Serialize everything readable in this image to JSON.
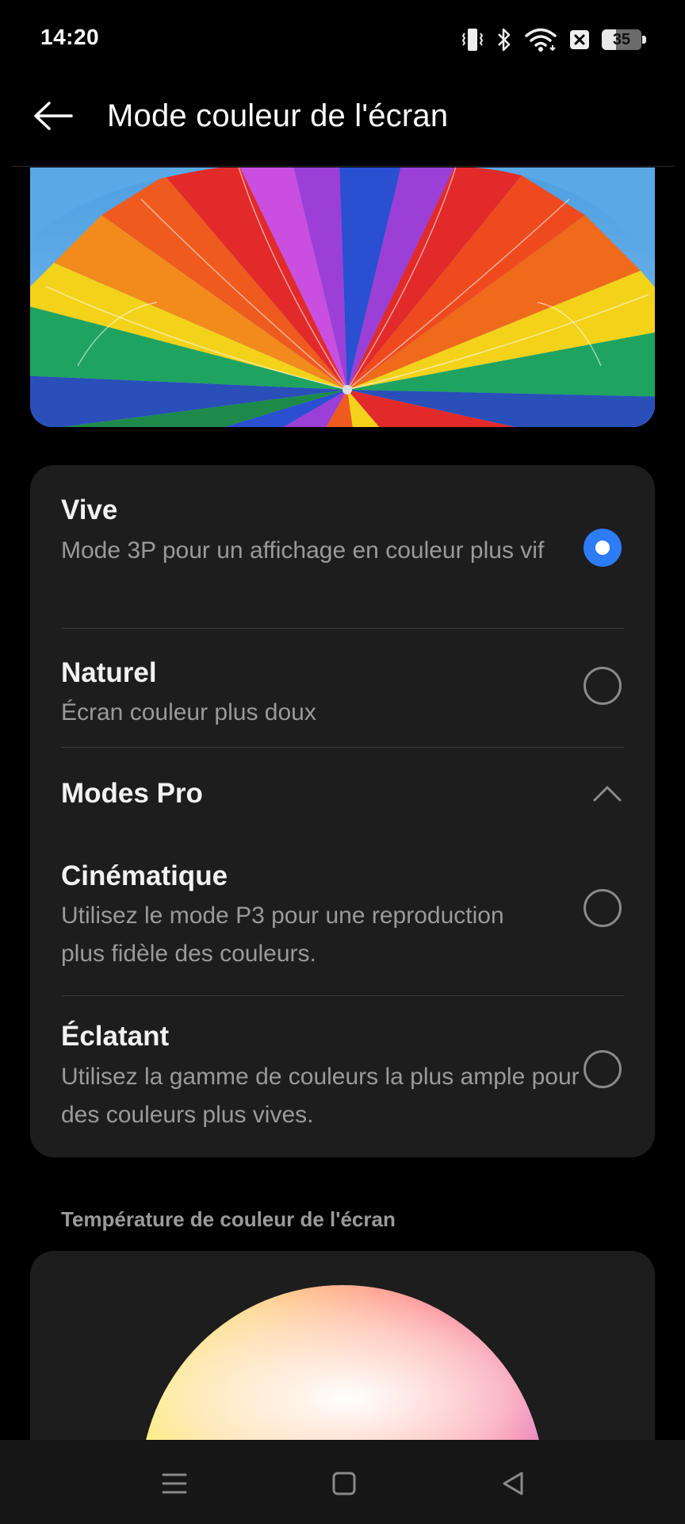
{
  "status_bar": {
    "time": "14:20",
    "icons": [
      "vibrate-icon",
      "bluetooth-icon",
      "wifi-icon",
      "close-box-icon"
    ],
    "battery_level": "35"
  },
  "header": {
    "title": "Mode couleur de l'écran",
    "back_icon": "arrow-left-icon"
  },
  "options": [
    {
      "title": "Vive",
      "description": "Mode 3P pour un affichage en couleur plus vif",
      "selected": true
    },
    {
      "title": "Naturel",
      "description": "Écran couleur plus doux",
      "selected": false
    }
  ],
  "pro_section": {
    "title": "Modes Pro",
    "expanded": true,
    "options": [
      {
        "title": "Cinématique",
        "description": "Utilisez le mode P3 pour une reproduction plus fidèle des couleurs.",
        "selected": false
      },
      {
        "title": "Éclatant",
        "description": "Utilisez la gamme de couleurs la plus ample pour des couleurs plus vives.",
        "selected": false
      }
    ]
  },
  "temperature": {
    "label": "Température de couleur de l'écran"
  },
  "nav_bar": {
    "buttons": [
      "menu-icon",
      "home-icon",
      "back-triangle-icon"
    ]
  },
  "colors": {
    "accent": "#2d7cf6",
    "card_bg": "#1d1d1d",
    "secondary_text": "#9a9a9a"
  }
}
